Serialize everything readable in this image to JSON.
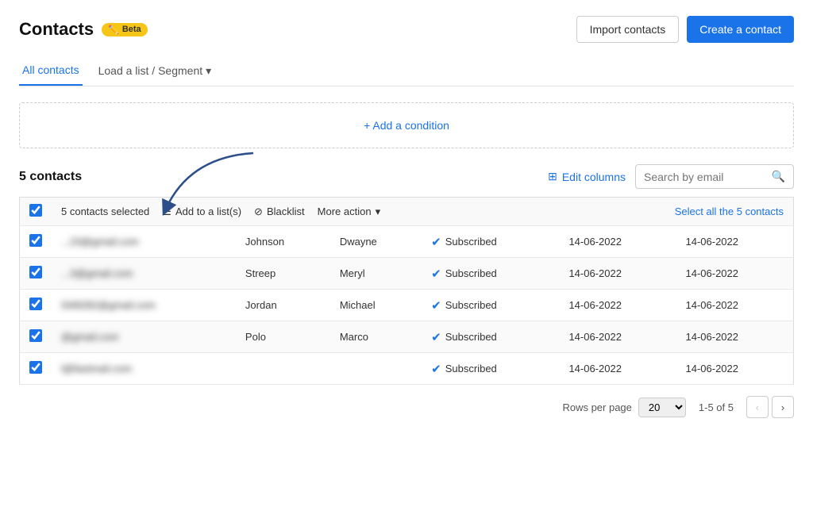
{
  "header": {
    "title": "Contacts",
    "beta_label": "Beta",
    "import_button": "Import contacts",
    "create_button": "Create a contact"
  },
  "tabs": [
    {
      "id": "all-contacts",
      "label": "All contacts",
      "active": true
    },
    {
      "id": "load-list",
      "label": "Load a list / Segment",
      "hasDropdown": true
    }
  ],
  "condition_bar": {
    "add_label": "+ Add a condition"
  },
  "table_meta": {
    "contacts_count": "5  contacts",
    "edit_columns": "Edit columns",
    "search_placeholder": "Search by email"
  },
  "action_row": {
    "selected_label": "5 contacts selected",
    "add_to_list": "Add to a list(s)",
    "blacklist": "Blacklist",
    "more_action": "More action",
    "select_all": "Select all the 5 contacts"
  },
  "contacts": [
    {
      "email": "...23@gmail.com",
      "last_name": "Johnson",
      "first_name": "Dwayne",
      "status": "Subscribed",
      "date1": "14-06-2022",
      "date2": "14-06-2022",
      "checked": true
    },
    {
      "email": "...3@gmail.com",
      "last_name": "Streep",
      "first_name": "Meryl",
      "status": "Subscribed",
      "date1": "14-06-2022",
      "date2": "14-06-2022",
      "checked": true
    },
    {
      "email": "l348282@gmail.com",
      "last_name": "Jordan",
      "first_name": "Michael",
      "status": "Subscribed",
      "date1": "14-06-2022",
      "date2": "14-06-2022",
      "checked": true
    },
    {
      "email": "@gmail.com",
      "last_name": "Polo",
      "first_name": "Marco",
      "status": "Subscribed",
      "date1": "14-06-2022",
      "date2": "14-06-2022",
      "checked": true
    },
    {
      "email": "l@fastmail.com",
      "last_name": "",
      "first_name": "",
      "status": "Subscribed",
      "date1": "14-06-2022",
      "date2": "14-06-2022",
      "checked": true
    }
  ],
  "pagination": {
    "rows_per_page_label": "Rows per page",
    "rows_value": "20",
    "page_info": "1-5 of 5"
  },
  "icons": {
    "pencil": "✏️",
    "grid": "⊞",
    "search": "🔍",
    "list": "☰",
    "block": "⊘",
    "chevron_down": "▾",
    "chevron_left": "‹",
    "chevron_right": "›",
    "check_circle": "✔"
  }
}
